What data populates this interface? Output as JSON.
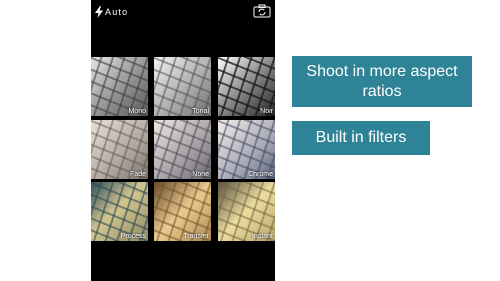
{
  "camera": {
    "flash_label": "Auto",
    "flash_icon": "lightning-bolt-icon",
    "switch_camera_icon": "camera-flip-icon"
  },
  "filters": [
    {
      "label": "Mono"
    },
    {
      "label": "Tonal"
    },
    {
      "label": "Noir"
    },
    {
      "label": "Fade"
    },
    {
      "label": "None"
    },
    {
      "label": "Chrome"
    },
    {
      "label": "Process"
    },
    {
      "label": "Transfer"
    },
    {
      "label": "Instant"
    }
  ],
  "callouts": {
    "aspect_ratios": "Shoot in more aspect ratios",
    "filters": "Built in filters"
  },
  "colors": {
    "callout_background": "#2e8396",
    "phone_background": "#000000",
    "callout_text": "#ffffff"
  }
}
